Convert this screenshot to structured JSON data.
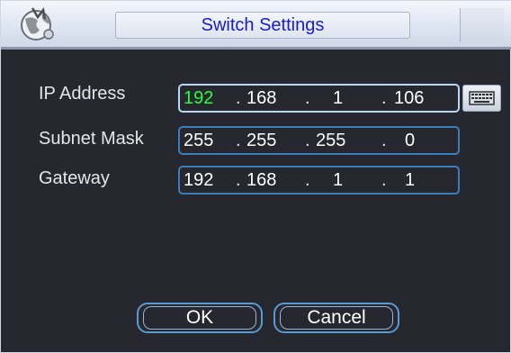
{
  "window": {
    "title": "Switch Settings"
  },
  "form": {
    "ip_address": {
      "label": "IP Address",
      "octets": [
        "192",
        "168",
        "1",
        "106"
      ]
    },
    "subnet_mask": {
      "label": "Subnet Mask",
      "octets": [
        "255",
        "255",
        "255",
        "0"
      ]
    },
    "gateway": {
      "label": "Gateway",
      "octets": [
        "192",
        "168",
        "1",
        "1"
      ]
    }
  },
  "buttons": {
    "ok_label": "OK",
    "cancel_label": "Cancel"
  },
  "icons": {
    "logo": "globe-logo-icon",
    "keyboard": "keyboard-icon"
  },
  "colors": {
    "title_text": "#1a1ad0",
    "selected_octet": "#27ff3a",
    "field_border": "#3c7fb8"
  }
}
